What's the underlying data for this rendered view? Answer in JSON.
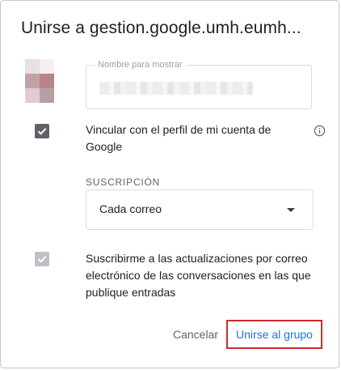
{
  "dialog": {
    "title": "Unirse a gestion.google.umh.eumh..."
  },
  "avatar": {
    "colors": [
      "#eadfe3",
      "#f6eef1",
      "#c4a0a6",
      "#b98486",
      "#e2cad0",
      "#b89fa5"
    ]
  },
  "name_field": {
    "label": "Nombre para mostrar"
  },
  "link_profile": {
    "checked": true,
    "label": "Vincular con el perfil de mi cuenta de Google"
  },
  "subscription": {
    "label": "SUSCRIPCIÓN",
    "selected": "Cada correo"
  },
  "updates": {
    "checked": true,
    "disabled": true,
    "label": "Suscribirme a las actualizaciones por correo electrónico de las conversaciones en las que publique entradas"
  },
  "actions": {
    "cancel_label": "Cancelar",
    "join_label": "Unirse al grupo"
  },
  "colors": {
    "accent": "#1a73e8",
    "highlight_border": "#d3282e",
    "checkbox_active": "#5f6368",
    "checkbox_disabled": "#bdc1c6"
  }
}
